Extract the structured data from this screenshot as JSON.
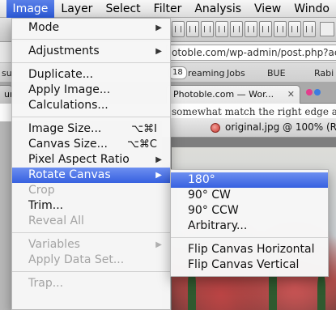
{
  "menubar": {
    "items": [
      {
        "label": ""
      },
      {
        "label": "Image"
      },
      {
        "label": "Layer"
      },
      {
        "label": "Select"
      },
      {
        "label": "Filter"
      },
      {
        "label": "Analysis"
      },
      {
        "label": "View"
      },
      {
        "label": "Windo"
      }
    ]
  },
  "background": {
    "url_text": "otoble.com/wp-admin/post.php?ac",
    "bookmarks": [
      "su",
      "reaming",
      "Jobs",
      "BUE",
      "Rabi"
    ],
    "bookmark_badge": "18",
    "tabs": [
      "ur",
      "Photoble.com — Wor..."
    ],
    "page_text": "somewhat match the right edge as t",
    "doc_title": "original.jpg @ 100% (R"
  },
  "image_menu": {
    "mode": "Mode",
    "adjustments": "Adjustments",
    "duplicate": "Duplicate...",
    "apply_image": "Apply Image...",
    "calculations": "Calculations...",
    "image_size": "Image Size...",
    "image_size_shortcut": "⌥⌘I",
    "canvas_size": "Canvas Size...",
    "canvas_size_shortcut": "⌥⌘C",
    "pixel_aspect_ratio": "Pixel Aspect Ratio",
    "rotate_canvas": "Rotate Canvas",
    "crop": "Crop",
    "trim": "Trim...",
    "reveal_all": "Reveal All",
    "variables": "Variables",
    "apply_data_set": "Apply Data Set...",
    "trap": "Trap..."
  },
  "rotate_submenu": {
    "rotate_180": "180°",
    "rotate_90_cw": "90° CW",
    "rotate_90_ccw": "90° CCW",
    "arbitrary": "Arbitrary...",
    "flip_horizontal": "Flip Canvas Horizontal",
    "flip_vertical": "Flip Canvas Vertical"
  },
  "icons": {
    "submenu_arrow": "▶",
    "close": "✕"
  },
  "colors": {
    "highlight": "#3761e0",
    "disabled_text": "#a3a3a3"
  }
}
